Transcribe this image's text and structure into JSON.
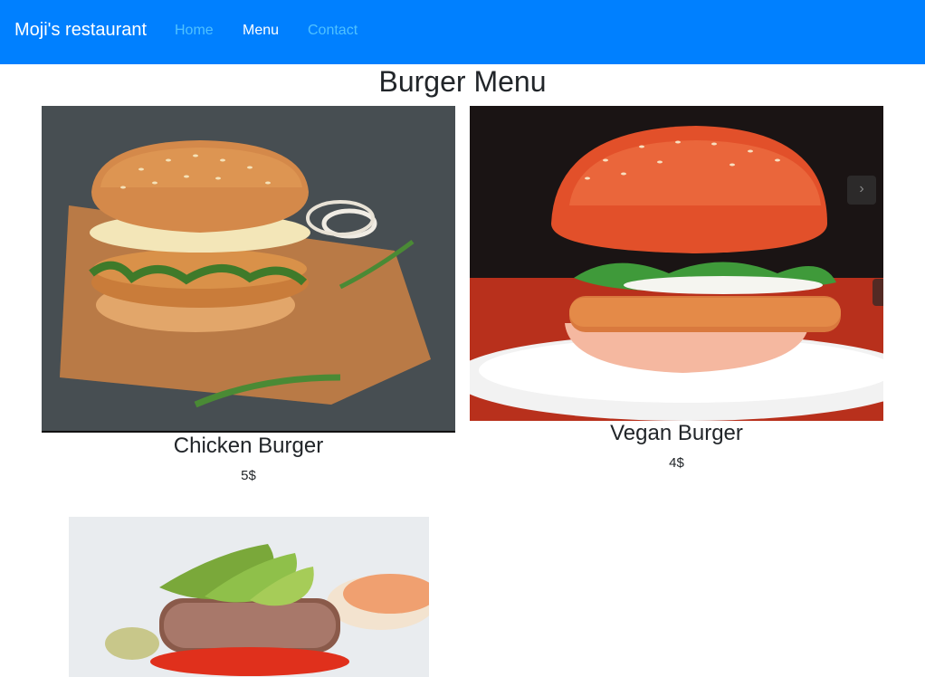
{
  "navbar": {
    "brand": "Moji's restaurant",
    "links": [
      {
        "label": "Home"
      },
      {
        "label": "Menu"
      },
      {
        "label": "Contact"
      }
    ],
    "background": "#0080ff"
  },
  "page": {
    "title": "Burger Menu"
  },
  "items": [
    {
      "name": "Chicken Burger",
      "price": "5$",
      "image": "chicken-burger-photo"
    },
    {
      "name": "Vegan Burger",
      "price": "4$",
      "image": "vegan-burger-photo"
    },
    {
      "image": "avocado-burger-photo"
    }
  ],
  "icons": {
    "carousel_next": "chevron-right-icon"
  }
}
